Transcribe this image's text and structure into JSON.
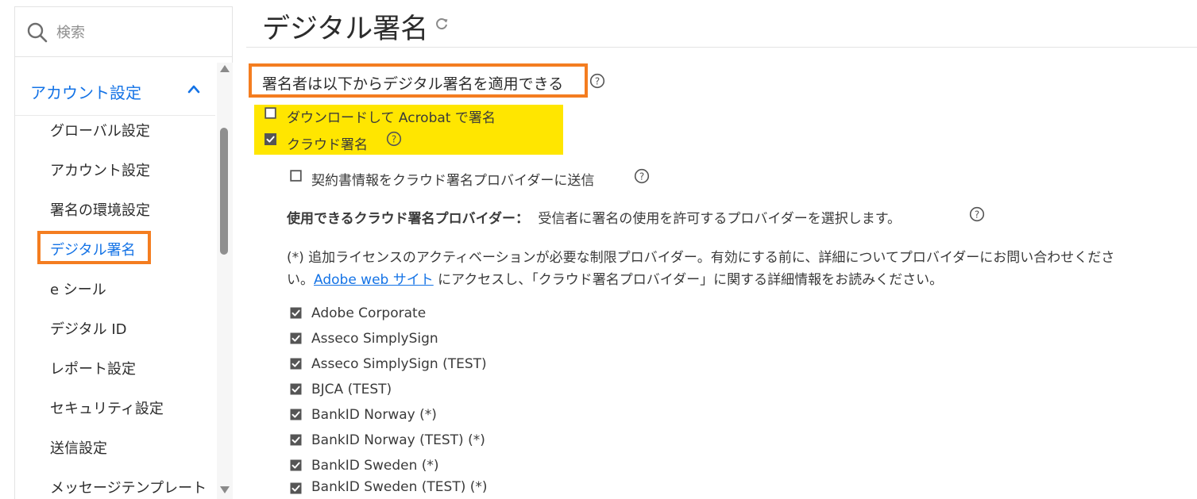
{
  "search": {
    "placeholder": "検索"
  },
  "sidebar": {
    "section_label": "アカウント設定",
    "items": [
      {
        "label": "グローバル設定"
      },
      {
        "label": "アカウント設定"
      },
      {
        "label": "署名の環境設定"
      },
      {
        "label": "デジタル署名"
      },
      {
        "label": "e シール"
      },
      {
        "label": "デジタル ID"
      },
      {
        "label": "レポート設定"
      },
      {
        "label": "セキュリティ設定"
      },
      {
        "label": "送信設定"
      },
      {
        "label": "メッセージテンプレート"
      }
    ],
    "active_item": "デジタル署名"
  },
  "main": {
    "title": "デジタル署名",
    "section_title": "署名者は以下からデジタル署名を適用できる",
    "options": [
      {
        "label": "ダウンロードして Acrobat で署名",
        "checked": false
      },
      {
        "label": "クラウド署名",
        "checked": true
      }
    ],
    "send_info": {
      "label": "契約書情報をクラウド署名プロバイダーに送信",
      "checked": false
    },
    "providers_heading": "使用できるクラウド署名プロバイダー：",
    "providers_desc": "受信者に署名の使用を許可するプロバイダーを選択します。",
    "note_line1": "(*) 追加ライセンスのアクティベーションが必要な制限プロバイダー。有効にする前に、詳細についてプロバイダーにお問い合わせくださ",
    "note_line2_prefix": "い。",
    "note_link": "Adobe web サイト",
    "note_line2_suffix": " にアクセスし、「クラウド署名プロバイダー」に関する詳細情報をお読みください。",
    "providers": [
      {
        "label": "Adobe Corporate",
        "checked": true
      },
      {
        "label": "Asseco SimplySign",
        "checked": true
      },
      {
        "label": "Asseco SimplySign (TEST)",
        "checked": true
      },
      {
        "label": "BJCA (TEST)",
        "checked": true
      },
      {
        "label": "BankID Norway (*)",
        "checked": true
      },
      {
        "label": "BankID Norway (TEST) (*)",
        "checked": true
      },
      {
        "label": "BankID Sweden (*)",
        "checked": true
      },
      {
        "label": "BankID Sweden (TEST) (*)",
        "checked": true
      }
    ]
  },
  "colors": {
    "accent": "#1473e6",
    "highlight_orange": "#f47d20",
    "highlight_yellow": "#ffe600"
  }
}
